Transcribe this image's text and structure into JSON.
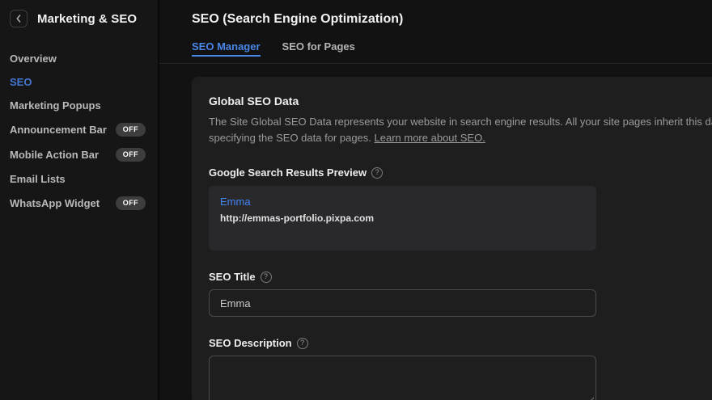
{
  "colors": {
    "background": "#121212",
    "sidebar_background": "#161616",
    "card_background": "#1e1e1f",
    "preview_box_background": "#29292c",
    "accent_blue": "#4a86e8",
    "sidebar_active_blue": "#4576d1",
    "link_blue": "#4285f4",
    "badge_background": "#3d3d3d"
  },
  "sidebar": {
    "title": "Marketing & SEO",
    "items": [
      {
        "label": "Overview",
        "badge": ""
      },
      {
        "label": "SEO",
        "badge": ""
      },
      {
        "label": "Marketing Popups",
        "badge": ""
      },
      {
        "label": "Announcement Bar",
        "badge": "OFF"
      },
      {
        "label": "Mobile Action Bar",
        "badge": "OFF"
      },
      {
        "label": "Email Lists",
        "badge": ""
      },
      {
        "label": "WhatsApp Widget",
        "badge": "OFF"
      }
    ]
  },
  "header": {
    "title": "SEO (Search Engine Optimization)"
  },
  "tabs": [
    {
      "label": "SEO Manager"
    },
    {
      "label": "SEO for Pages"
    }
  ],
  "card": {
    "heading": "Global SEO Data",
    "description_line1": "The Site Global SEO Data represents your website in search engine results. All your site pages inherit this data. You can override this",
    "description_line2": "specifying the SEO data for pages. ",
    "link_text": "Learn more about SEO.",
    "preview": {
      "label": "Google Search Results Preview",
      "help": "?",
      "title": "Emma",
      "url": "http://emmas-portfolio.pixpa.com"
    },
    "seo_title": {
      "label": "SEO Title",
      "help": "?",
      "value": "Emma"
    },
    "seo_description": {
      "label": "SEO Description",
      "help": "?",
      "value": ""
    }
  }
}
